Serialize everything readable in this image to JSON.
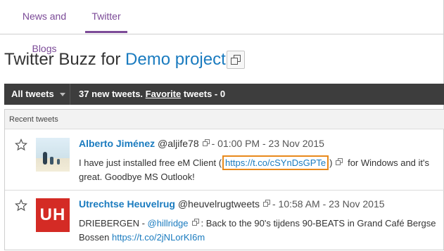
{
  "tabs": [
    {
      "label": "News and Blogs",
      "active": false
    },
    {
      "label": "Twitter",
      "active": true
    }
  ],
  "page": {
    "title_prefix": "Twitter Buzz for ",
    "project_name": "Demo project"
  },
  "toolbar": {
    "filter_label": "All tweets",
    "new_tweets": "37 new tweets.",
    "favorite_label": "Favorite",
    "favorite_tweets": " tweets - 0"
  },
  "list": {
    "header": "Recent tweets",
    "tweets": [
      {
        "name": "Alberto Jiménez",
        "handle": "@aljife78",
        "time": "- 01:00 PM - 23 Nov 2015",
        "text_before": "I have just installed free eM Client (",
        "link": "https://t.co/cSYnDsGPTe",
        "text_after": ")",
        "text_end": "for Windows and it's great. Goodbye MS Outlook!"
      },
      {
        "name": "Utrechtse Heuvelrug",
        "handle": "@heuvelrugtweets",
        "time": "- 10:58 AM - 23 Nov 2015",
        "avatar_text": "UH",
        "text_before": "DRIEBERGEN - ",
        "mention": "@hillridge",
        "text_mid": ": Back to the 90's tijdens 90-BEATS in Grand Café Bergse Bossen ",
        "link": "https://t.co/2jNLorKI6m"
      }
    ]
  },
  "colors": {
    "accent": "#7b4a97",
    "link": "#1a7bbf",
    "toolbar_bg": "#3d3d3d",
    "highlight": "#e8891b",
    "uh_red": "#d42b25"
  }
}
